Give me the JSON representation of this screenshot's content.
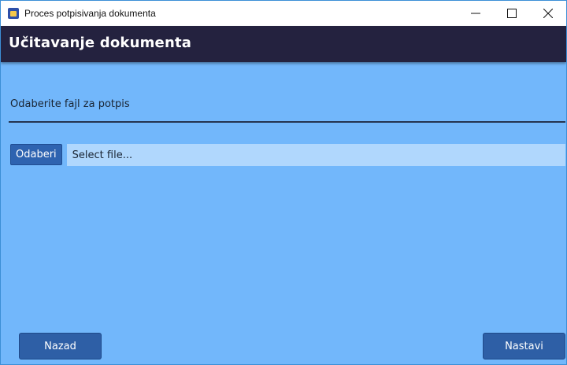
{
  "window": {
    "title": "Proces potpisivanja dokumenta",
    "minimize_symbol": "—",
    "maximize_symbol": "☐",
    "close_symbol": "✕"
  },
  "header": {
    "title": "Učitavanje dokumenta"
  },
  "main": {
    "subtitle": "Odaberite fajl za potpis",
    "choose_button": "Odaberi",
    "file_placeholder": "Select file..."
  },
  "footer": {
    "back_label": "Nazad",
    "next_label": "Nastavi"
  },
  "icons": {
    "app": "app-icon",
    "minimize": "minimize-icon",
    "maximize": "maximize-icon",
    "close": "close-icon"
  },
  "colors": {
    "background": "#72b7fb",
    "header": "#24223f",
    "button": "#2e5fa6",
    "input": "#b0d7fd"
  }
}
